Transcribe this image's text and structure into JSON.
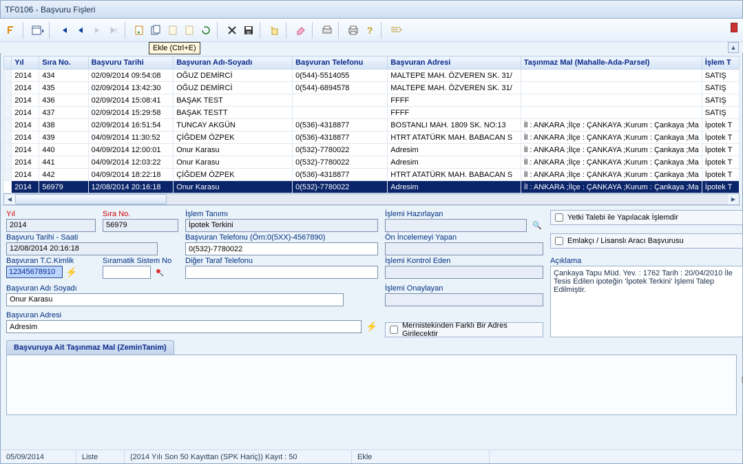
{
  "window": {
    "title": "TF0106 - Başvuru Fişleri"
  },
  "toolbar": {
    "tooltip": "Ekle (Ctrl+E)"
  },
  "grid": {
    "headers": [
      "Yıl",
      "Sıra No.",
      "Başvuru Tarihi",
      "Başvuran Adı-Soyadı",
      "Başvuran Telefonu",
      "Başvuran Adresi",
      "Taşınmaz Mal (Mahalle-Ada-Parsel)",
      "İşlem T"
    ],
    "rows": [
      {
        "yil": "2014",
        "sno": "434",
        "tar": "02/09/2014 09:54:08",
        "ad": "OĞUZ DEMİRCİ",
        "tel": "0(544)-5514055",
        "adr": "MALTEPE MAH. ÖZVEREN SK. 31/",
        "mal": "",
        "isl": "SATIŞ"
      },
      {
        "yil": "2014",
        "sno": "435",
        "tar": "02/09/2014 13:42:30",
        "ad": "OĞUZ DEMİRCİ",
        "tel": "0(544)-6894578",
        "adr": "MALTEPE MAH. ÖZVEREN SK. 31/",
        "mal": "",
        "isl": "SATIŞ"
      },
      {
        "yil": "2014",
        "sno": "436",
        "tar": "02/09/2014 15:08:41",
        "ad": "BAŞAK TEST",
        "tel": "",
        "adr": "FFFF",
        "mal": "",
        "isl": "SATIŞ"
      },
      {
        "yil": "2014",
        "sno": "437",
        "tar": "02/09/2014 15:29:58",
        "ad": "BAŞAK TESTT",
        "tel": "",
        "adr": "FFFF",
        "mal": "",
        "isl": "SATIŞ"
      },
      {
        "yil": "2014",
        "sno": "438",
        "tar": "02/09/2014 16:51:54",
        "ad": "TUNCAY  AKGÜN",
        "tel": "0(536)-4318877",
        "adr": "BOSTANLI MAH. 1809 SK.  NO:13",
        "mal": "İl : ANKARA ;İlçe : ÇANKAYA ;Kurum : Çankaya ;Ma",
        "isl": "İpotek T"
      },
      {
        "yil": "2014",
        "sno": "439",
        "tar": "04/09/2014 11:30:52",
        "ad": "ÇİĞDEM   ÖZPEK",
        "tel": "0(536)-4318877",
        "adr": "HTRT ATATÜRK MAH. BABACAN S",
        "mal": "İl : ANKARA ;İlçe : ÇANKAYA ;Kurum : Çankaya ;Ma",
        "isl": "İpotek T"
      },
      {
        "yil": "2014",
        "sno": "440",
        "tar": "04/09/2014 12:00:01",
        "ad": "Onur Karasu",
        "tel": "0(532)-7780022",
        "adr": "Adresim",
        "mal": "İl : ANKARA ;İlçe : ÇANKAYA ;Kurum : Çankaya ;Ma",
        "isl": "İpotek T"
      },
      {
        "yil": "2014",
        "sno": "441",
        "tar": "04/09/2014 12:03:22",
        "ad": "Onur Karasu",
        "tel": "0(532)-7780022",
        "adr": "Adresim",
        "mal": "İl : ANKARA ;İlçe : ÇANKAYA ;Kurum : Çankaya ;Ma",
        "isl": "İpotek T"
      },
      {
        "yil": "2014",
        "sno": "442",
        "tar": "04/09/2014 18:22:18",
        "ad": "ÇİĞDEM   ÖZPEK",
        "tel": "0(536)-4318877",
        "adr": "HTRT ATATÜRK MAH. BABACAN S",
        "mal": "İl : ANKARA ;İlçe : ÇANKAYA ;Kurum : Çankaya ;Ma",
        "isl": "İpotek T"
      },
      {
        "yil": "2014",
        "sno": "56979",
        "tar": "12/08/2014 20:16:18",
        "ad": "Onur Karasu",
        "tel": "0(532)-7780022",
        "adr": "Adresim",
        "mal": "İl : ANKARA ;İlçe : ÇANKAYA ;Kurum : Çankaya ;Ma",
        "isl": "İpotek T",
        "sel": true
      }
    ]
  },
  "form": {
    "yil": {
      "label": "Yıl",
      "value": "2014"
    },
    "sirano": {
      "label": "Sıra No.",
      "value": "56979"
    },
    "islemtanimi": {
      "label": "İşlem Tanımı",
      "value": "İpotek Terkini"
    },
    "islemhazirlayan": {
      "label": "İşlemi Hazırlayan",
      "value": ""
    },
    "basvurutarihi": {
      "label": "Başvuru Tarihi - Saati",
      "value": "12/08/2014 20:16:18"
    },
    "basvurantelefonu": {
      "label": "Başvuran Telefonu  (Örn:0(5XX)-4567890)",
      "value": "0(532)-7780022"
    },
    "oninceleme": {
      "label": "Ön İncelemeyi Yapan",
      "value": ""
    },
    "tckimlik": {
      "label": "Başvuran T.C.Kimlik",
      "value": "12345678910"
    },
    "siramatik": {
      "label": "Sıramatik Sistem No",
      "value": ""
    },
    "digertaraf": {
      "label": "Diğer Taraf Telefonu",
      "value": ""
    },
    "islemkontrol": {
      "label": "İşlemi Kontrol Eden",
      "value": ""
    },
    "adsoyad": {
      "label": "Başvuran Adı Soyadı",
      "value": "Onur Karasu"
    },
    "islemonaylayan": {
      "label": "İşlemi Onaylayan",
      "value": ""
    },
    "adresi": {
      "label": "Başvuran Adresi",
      "value": "Adresim"
    },
    "mernis_chk": {
      "label": "Mernistekinden Farklı Bir Adres Girilecektir"
    },
    "yetki_chk": {
      "label": "Yetki Talebi ile Yapılacak İşlemdir"
    },
    "emlakci_chk": {
      "label": "Emlakçı / Lisanslı Aracı Başvurusu"
    },
    "aciklama": {
      "label": "Açıklama",
      "value": "Çankaya Tapu Müd.  Yev. : 1762 Tarih : 20/04/2010 İle Tesis Edilen ipoteğin 'İpotek Terkini' İşlemi Talep Edilmiştir."
    }
  },
  "tab": {
    "label": "Başvuruya Ait Taşınmaz Mal (ZeminTanim)"
  },
  "status": {
    "date": "05/09/2014",
    "mode": "Liste",
    "recinfo": "(2014 Yılı Son 50 Kayıttan  (SPK Hariç)) Kayıt : 50",
    "op": "Ekle"
  }
}
